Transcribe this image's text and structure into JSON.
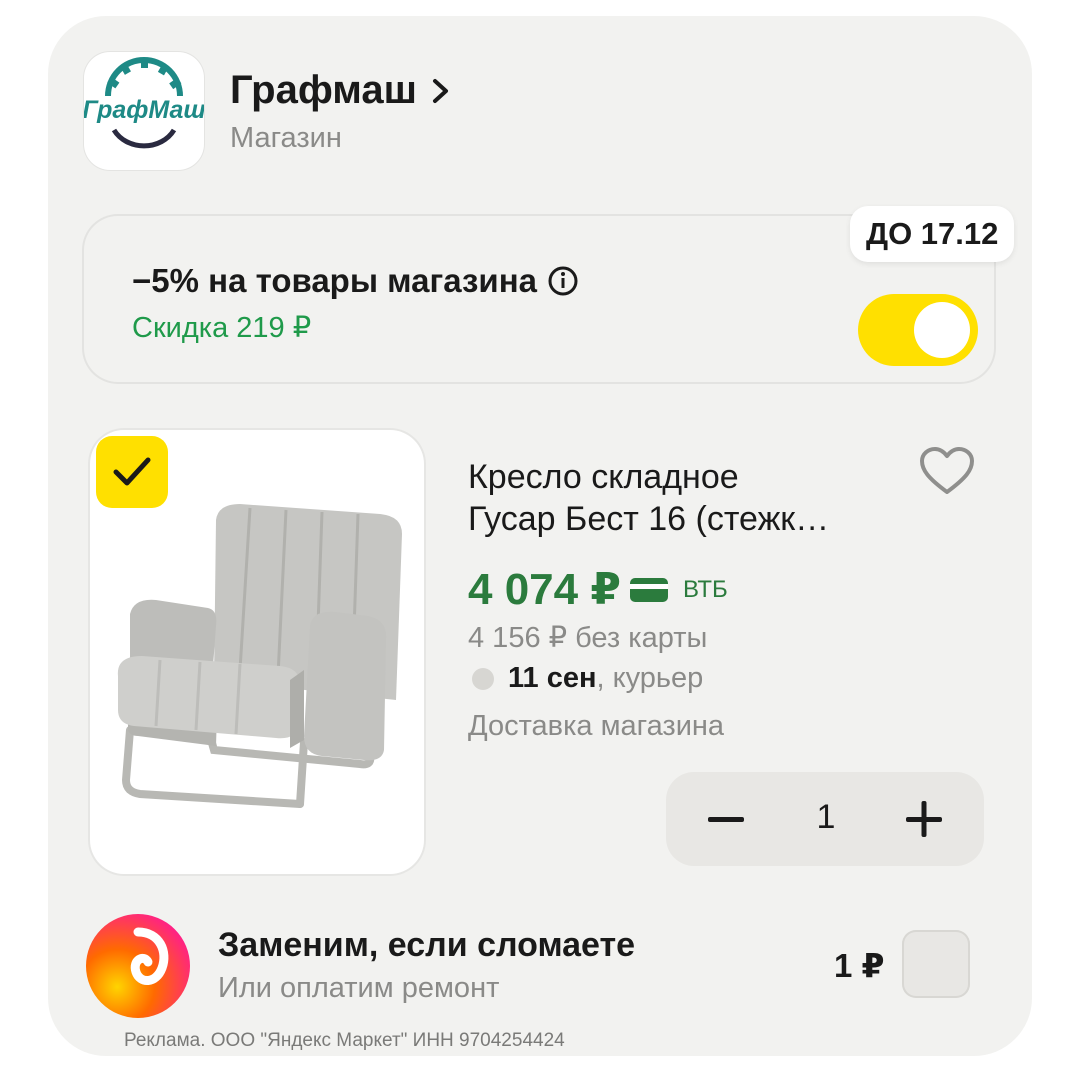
{
  "store": {
    "name": "Графмаш",
    "subtitle": "Магазин",
    "logo_text": "ГрафМаш",
    "logo_icon": "gear-logo"
  },
  "promo": {
    "title": "−5% на товары магазина",
    "subtitle": "Скидка 219 ₽",
    "date_badge": "ДО 17.12",
    "toggle_on": true,
    "info_icon": "info-icon"
  },
  "product": {
    "selected": true,
    "title_line1": "Кресло складное",
    "title_line2": "Гусар Бест 16 (стежк…",
    "price": "4 074 ₽",
    "bank": "ВТБ",
    "old_price": "4 156 ₽  без карты",
    "delivery_date": "11 сен",
    "delivery_method": ", курьер",
    "store_delivery": "Доставка магазина",
    "quantity": "1"
  },
  "insurance": {
    "title": "Заменим, если сломаете",
    "subtitle": "Или оплатим ремонт",
    "price": "1 ₽"
  },
  "footer": {
    "ad_note": "Реклама. ООО \"Яндекс Маркет\" ИНН 9704254424"
  },
  "colors": {
    "accent_yellow": "#ffe000",
    "price_green": "#2b7b3d",
    "discount_green": "#1f9a4a",
    "card_bg": "#f2f2f0"
  }
}
